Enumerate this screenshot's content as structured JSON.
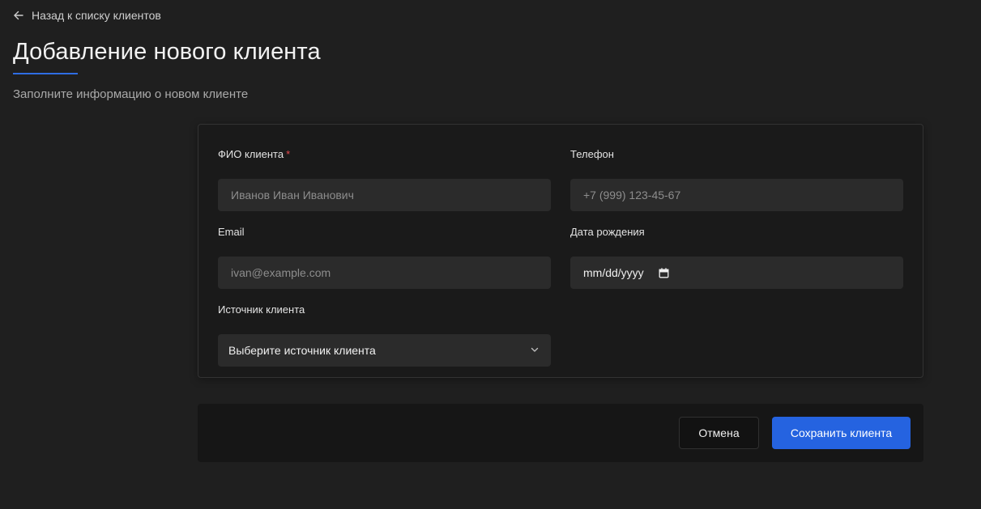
{
  "nav": {
    "back_label": "Назад к списку клиентов"
  },
  "header": {
    "title": "Добавление нового клиента",
    "subtitle": "Заполните информацию о новом клиенте"
  },
  "form": {
    "full_name": {
      "label": "ФИО клиента",
      "required_mark": "*",
      "placeholder": "Иванов Иван Иванович"
    },
    "phone": {
      "label": "Телефон",
      "placeholder": "+7 (999) 123-45-67"
    },
    "email": {
      "label": "Email",
      "placeholder": "ivan@example.com"
    },
    "birth_date": {
      "label": "Дата рождения",
      "value": "mm/dd/yyyy"
    },
    "source": {
      "label": "Источник клиента",
      "selected": "Выберите источник клиента"
    }
  },
  "actions": {
    "cancel_label": "Отмена",
    "save_label": "Сохранить клиента"
  },
  "colors": {
    "background": "#1f1f1f",
    "card": "#1a1a1a",
    "input": "#2b2b2b",
    "accent": "#2563e0",
    "required": "#e5484d"
  }
}
